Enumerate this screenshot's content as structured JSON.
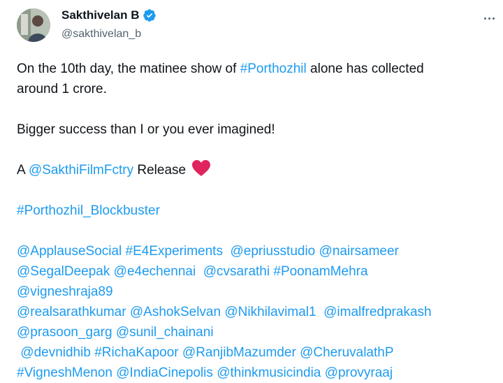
{
  "author": {
    "display_name": "Sakthivelan B",
    "handle": "@sakthivelan_b"
  },
  "colors": {
    "link": "#1d9bf0",
    "text": "#0f1419",
    "muted": "#536471",
    "verified": "#1d9bf0",
    "heart": "#e0245e"
  },
  "tweet": {
    "p1_text1": "On the 10th day, the matinee show of ",
    "p1_hashtag": "#Porthozhil",
    "p1_text2": " alone has collected",
    "p1_line2": "around 1 crore.",
    "p2": "Bigger success than I or you ever imagined!",
    "p3_prefix": "A ",
    "p3_mention": "@SakthiFilmFctry",
    "p3_suffix": " Release ",
    "p3_emoji": "heart-emoji",
    "p4_hashtag": "#Porthozhil_Blockbuster",
    "tags_line1": [
      "@ApplauseSocial",
      "#E4Experiments",
      "@epriusstudio",
      "@nairsameer"
    ],
    "tags_line2": [
      "@SegalDeepak",
      "@e4echennai",
      "@cvsarathi",
      "#PoonamMehra"
    ],
    "tags_line3": [
      "@vigneshraja89"
    ],
    "tags_line4": [
      "@realsarathkumar",
      "@AshokSelvan",
      "@Nikhilavimal1",
      "@imalfredprakash"
    ],
    "tags_line5": [
      "@prasoon_garg",
      "@sunil_chainani"
    ],
    "tags_line6": [
      "@devnidhib",
      "#RichaKapoor",
      "@RanjibMazumder",
      "@CheruvalathP"
    ],
    "tags_line7": [
      "#VigneshMenon",
      "@IndiaCinepolis",
      "@thinkmusicindia",
      "@provyraaj"
    ]
  }
}
